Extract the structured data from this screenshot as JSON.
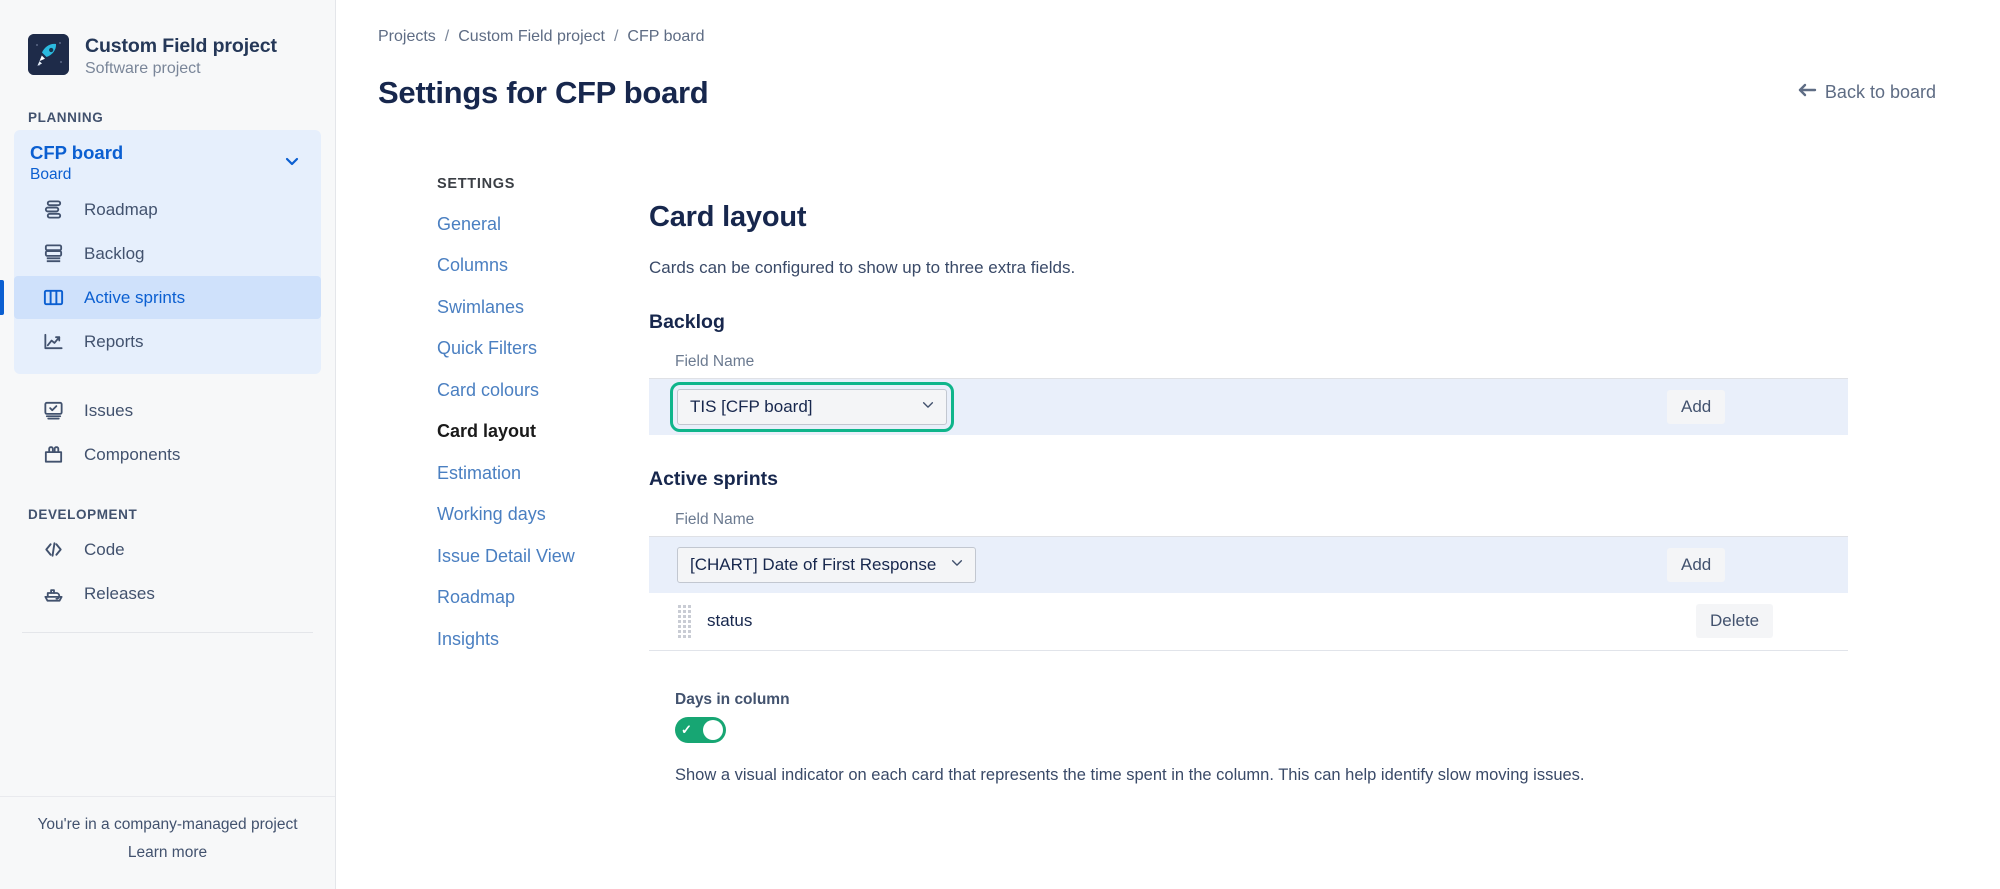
{
  "sidebar": {
    "project": {
      "name": "Custom Field project",
      "type": "Software project",
      "avatar_icon": "rocket-icon",
      "avatar_bg": "#1e2b49"
    },
    "planning_label": "PLANNING",
    "board": {
      "title": "CFP board",
      "subtitle": "Board",
      "chevron_icon": "chevron-down-icon"
    },
    "board_items": [
      {
        "label": "Roadmap",
        "icon": "roadmap-icon",
        "selected": false
      },
      {
        "label": "Backlog",
        "icon": "backlog-icon",
        "selected": false
      },
      {
        "label": "Active sprints",
        "icon": "board-columns-icon",
        "selected": true
      },
      {
        "label": "Reports",
        "icon": "reports-chart-icon",
        "selected": false
      }
    ],
    "project_items": [
      {
        "label": "Issues",
        "icon": "issues-icon"
      },
      {
        "label": "Components",
        "icon": "components-icon"
      }
    ],
    "development_label": "DEVELOPMENT",
    "development_items": [
      {
        "label": "Code",
        "icon": "code-icon"
      },
      {
        "label": "Releases",
        "icon": "releases-ship-icon"
      }
    ],
    "footer": {
      "note": "You're in a company-managed project",
      "link": "Learn more"
    }
  },
  "header": {
    "breadcrumb": [
      "Projects",
      "Custom Field project",
      "CFP board"
    ],
    "separator": "/",
    "title": "Settings for CFP board",
    "back_link": "Back to board",
    "back_icon": "arrow-left-icon"
  },
  "settings_nav": {
    "label": "SETTINGS",
    "items": [
      {
        "label": "General",
        "active": false
      },
      {
        "label": "Columns",
        "active": false
      },
      {
        "label": "Swimlanes",
        "active": false
      },
      {
        "label": "Quick Filters",
        "active": false
      },
      {
        "label": "Card colours",
        "active": false
      },
      {
        "label": "Card layout",
        "active": true
      },
      {
        "label": "Estimation",
        "active": false
      },
      {
        "label": "Working days",
        "active": false
      },
      {
        "label": "Issue Detail View",
        "active": false
      },
      {
        "label": "Roadmap",
        "active": false
      },
      {
        "label": "Insights",
        "active": false
      }
    ]
  },
  "panel": {
    "title": "Card layout",
    "description": "Cards can be configured to show up to three extra fields.",
    "backlog": {
      "heading": "Backlog",
      "field_label": "Field Name",
      "selected_field": "TIS [CFP board]",
      "options": [
        "TIS [CFP board]"
      ],
      "add_label": "Add",
      "highlighted": true,
      "highlight_color": "#0fb58b"
    },
    "active_sprints": {
      "heading": "Active sprints",
      "field_label": "Field Name",
      "selected_field": "[CHART] Date of First Response",
      "options": [
        "[CHART] Date of First Response"
      ],
      "add_label": "Add",
      "rows": [
        {
          "label": "status",
          "delete_label": "Delete"
        }
      ]
    },
    "days_in_column": {
      "label": "Days in column",
      "enabled": true,
      "toggle_check": "✓",
      "description": "Show a visual indicator on each card that represents the time spent in the column. This can help identify slow moving issues."
    }
  }
}
